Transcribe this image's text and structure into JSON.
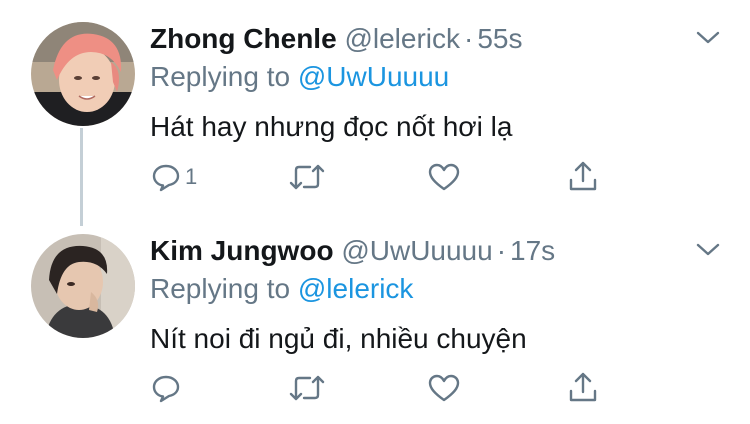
{
  "tweets": [
    {
      "name": "Zhong Chenle",
      "handle": "@lelerick",
      "separator": "·",
      "time": "55s",
      "replying_prefix": "Replying to",
      "replying_handle": "@UwUuuuu",
      "text": "Hát hay nhưng đọc nốt hơi lạ",
      "reply_count": "1"
    },
    {
      "name": "Kim Jungwoo",
      "handle": "@UwUuuuu",
      "separator": "·",
      "time": "17s",
      "replying_prefix": "Replying to",
      "replying_handle": "@lelerick",
      "text": "Nít noi đi ngủ đi, nhiều chuyện",
      "reply_count": ""
    }
  ],
  "icons": {
    "reply": "reply-icon",
    "retweet": "retweet-icon",
    "like": "heart-icon",
    "share": "share-icon",
    "menu": "chevron-down-icon"
  },
  "colors": {
    "name": "#14171a",
    "muted": "#657786",
    "link": "#1b95e0",
    "thread_line": "#c4cfd6"
  }
}
